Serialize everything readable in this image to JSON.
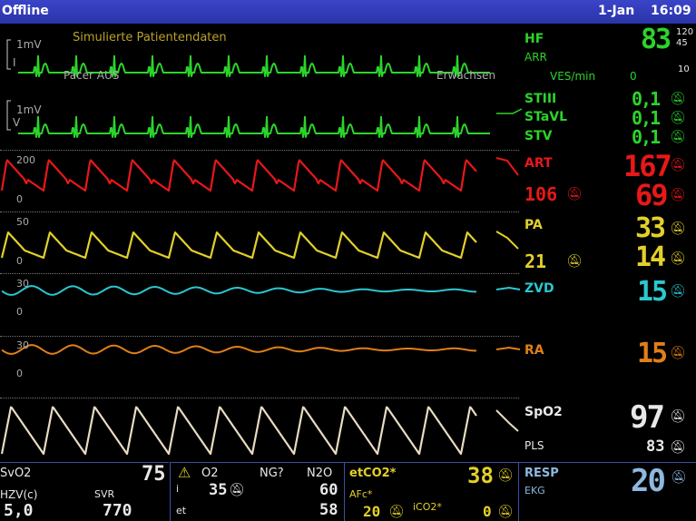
{
  "titlebar": {
    "status": "Offline",
    "date": "1-Jan",
    "time": "16:09"
  },
  "ecg1": {
    "scale": "1mV",
    "lead": "I",
    "caption": "Simulierte Patientendaten",
    "pacer": "Pacer AUS",
    "patient_type": "Erwachsen"
  },
  "ecg2": {
    "scale": "1mV",
    "lead": "V"
  },
  "hf": {
    "label": "HF",
    "sub": "ARR",
    "value": "83",
    "alarm_high": "120",
    "alarm_low": "45",
    "ves_label": "VES/min",
    "ves_value": "0",
    "ves_limit": "10"
  },
  "st": [
    {
      "label": "STIII",
      "value": "0,1"
    },
    {
      "label": "STaVL",
      "value": "0,1"
    },
    {
      "label": "STV",
      "value": "0,1"
    }
  ],
  "art": {
    "label": "ART",
    "scale_top": "200",
    "scale_bottom": "0",
    "systolic": "167",
    "diastolic": "69",
    "mean": "106"
  },
  "pa": {
    "label": "PA",
    "scale_top": "50",
    "scale_bottom": "0",
    "systolic": "33",
    "diastolic": "14",
    "mean": "21"
  },
  "zvd": {
    "label": "ZVD",
    "scale_top": "30",
    "scale_bottom": "0",
    "value": "15"
  },
  "ra": {
    "label": "RA",
    "scale_top": "30",
    "scale_bottom": "0",
    "value": "15"
  },
  "spo2": {
    "label": "SpO2",
    "value": "97",
    "pls_label": "PLS",
    "pls_value": "83"
  },
  "bottom": {
    "svo2": {
      "label": "SvO2",
      "value": "75",
      "hzv_label": "HZV(c)",
      "hzv_value": "5,0",
      "svr_label": "SVR",
      "svr_value": "770"
    },
    "gas": {
      "o2_label": "O2",
      "i_label": "i",
      "o2_value": "35",
      "ng_label": "NG?",
      "n2o_label": "N2O",
      "n2o_i": "60",
      "et_label": "et",
      "n2o_et": "58"
    },
    "etco2": {
      "label": "etCO2*",
      "value": "38",
      "afc_label": "AFc*",
      "afc_value": "20",
      "ico2_label": "iCO2*",
      "ico2_value": "0"
    },
    "resp": {
      "label": "RESP",
      "source": "EKG",
      "value": "20"
    }
  },
  "colors": {
    "ecg": "#2bd42b",
    "art": "#e81818",
    "pa": "#e3d02a",
    "zvd": "#2ac8d0",
    "ra": "#e07f18",
    "spo2": "#e8dcc0",
    "titlebar": "#2a34a8"
  },
  "icons": [
    "alarm-off-bell-icon",
    "warning-triangle-icon"
  ]
}
